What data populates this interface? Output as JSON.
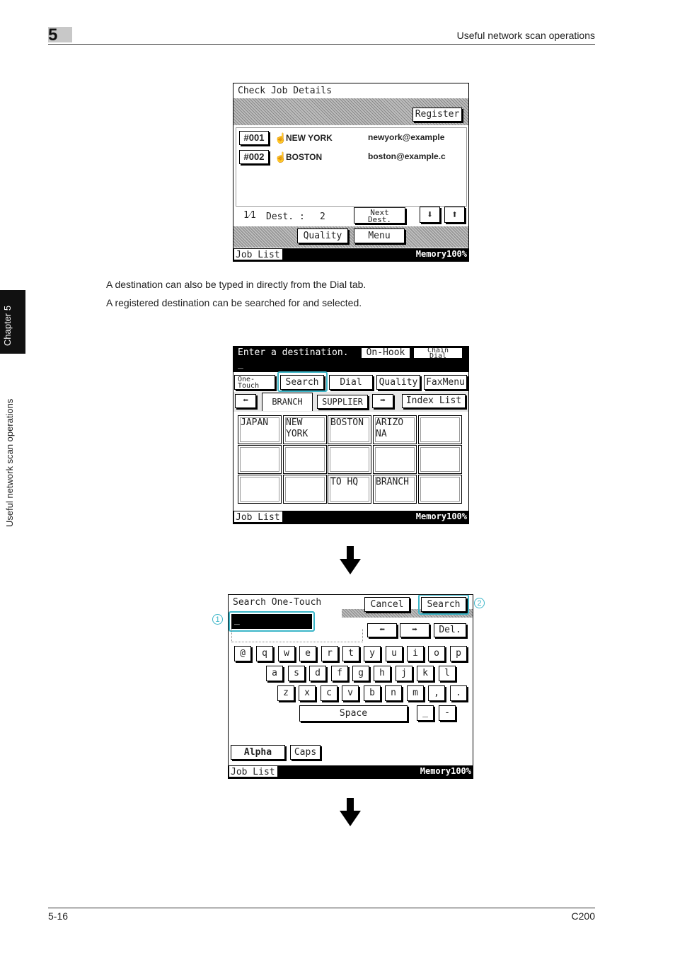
{
  "header": {
    "chapter_number": "5",
    "title": "Useful network scan operations"
  },
  "side": {
    "tab_label": "Chapter 5",
    "section_label": "Useful network scan operations"
  },
  "footer": {
    "page": "5-16",
    "model": "C200"
  },
  "paragraphs": [
    "A destination can also be typed in directly from the Dial tab.",
    "A registered destination can be searched for and selected."
  ],
  "screen1": {
    "title": "Check Job Details",
    "register": "Register",
    "rows": [
      {
        "num": "#001",
        "name": "NEW YORK",
        "addr": "newyork@example"
      },
      {
        "num": "#002",
        "name": "BOSTON",
        "addr": "boston@example.c"
      }
    ],
    "page": "1⁄1",
    "dest_label": "Dest. :",
    "dest_count": "2",
    "next_dest": "Next Dest.",
    "quality": "Quality",
    "menu": "Menu",
    "job_list": "Job List",
    "memory": "Memory100%"
  },
  "screen2": {
    "title": "Enter a destination.",
    "onhook": "On-Hook",
    "chain_dial": "Chain Dial",
    "tabs": [
      "One-Touch",
      "Search",
      "Dial",
      "Quality",
      "FaxMenu"
    ],
    "branch": "BRANCH",
    "supplier": "SUPPLIER",
    "index_list": "Index List",
    "cells": [
      "JAPAN",
      "NEW\nYORK",
      "BOSTON",
      "ARIZO\nNA",
      "",
      "",
      "",
      "",
      "",
      "",
      "",
      "",
      "TO HQ",
      "BRANCH",
      ""
    ],
    "job_list": "Job List",
    "memory": "Memory100%"
  },
  "screen3": {
    "title": "Search One-Touch",
    "cancel": "Cancel",
    "search": "Search",
    "del": "Del.",
    "row1": [
      "@",
      "q",
      "w",
      "e",
      "r",
      "t",
      "y",
      "u",
      "i",
      "o",
      "p"
    ],
    "row2": [
      "a",
      "s",
      "d",
      "f",
      "g",
      "h",
      "j",
      "k",
      "l"
    ],
    "row3": [
      "z",
      "x",
      "c",
      "v",
      "b",
      "n",
      "m",
      ",",
      "."
    ],
    "space": "Space",
    "underscore": "_",
    "dash": "-",
    "alpha": "Alpha",
    "caps": "Caps",
    "callout1": "1",
    "callout2": "2",
    "job_list": "Job List",
    "memory": "Memory100%"
  }
}
